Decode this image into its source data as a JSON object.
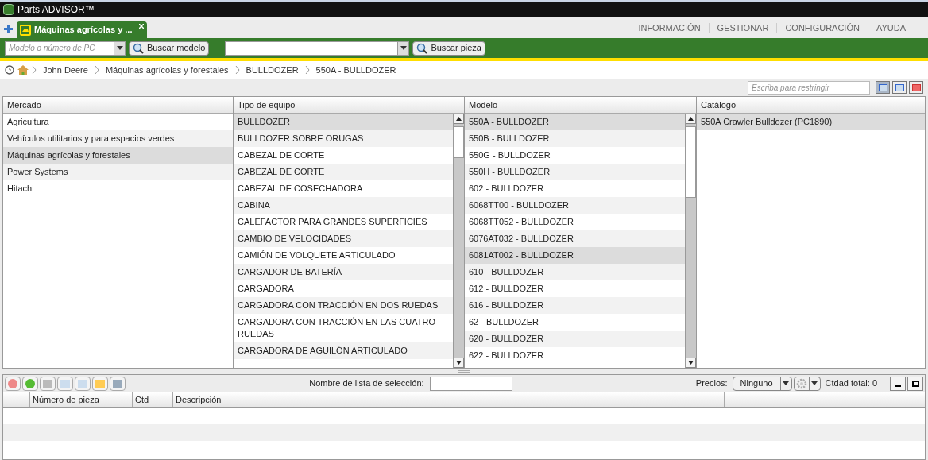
{
  "window": {
    "title": "Parts ADVISOR™"
  },
  "tabs": [
    {
      "label": "Máquinas agrícolas y ...",
      "selected": true
    }
  ],
  "top_menu": [
    "INFORMACIÓN",
    "GESTIONAR",
    "CONFIGURACIÓN",
    "AYUDA"
  ],
  "search": {
    "model_placeholder": "Modelo o número de PC",
    "model_button": "Buscar modelo",
    "part_button": "Buscar pieza"
  },
  "breadcrumb": [
    "John Deere",
    "Máquinas agrícolas y forestales",
    "BULLDOZER",
    "550A - BULLDOZER"
  ],
  "filter": {
    "placeholder": "Escriba para restringir"
  },
  "columns": [
    {
      "header": "Mercado",
      "items": [
        {
          "label": "Agricultura",
          "selected": false
        },
        {
          "label": "Vehículos utilitarios y para espacios verdes",
          "selected": false
        },
        {
          "label": "Máquinas agrícolas y forestales",
          "selected": true
        },
        {
          "label": "Power Systems",
          "selected": false
        },
        {
          "label": "Hitachi",
          "selected": false
        }
      ]
    },
    {
      "header": "Tipo de equipo",
      "items": [
        {
          "label": "BULLDOZER",
          "selected": true
        },
        {
          "label": "BULLDOZER SOBRE ORUGAS",
          "selected": false
        },
        {
          "label": "CABEZAL DE CORTE",
          "selected": false
        },
        {
          "label": "CABEZAL DE CORTE",
          "selected": false
        },
        {
          "label": "CABEZAL DE COSECHADORA",
          "selected": false
        },
        {
          "label": "CABINA",
          "selected": false
        },
        {
          "label": "CALEFACTOR PARA GRANDES SUPERFICIES",
          "selected": false
        },
        {
          "label": "CAMBIO DE VELOCIDADES",
          "selected": false
        },
        {
          "label": "CAMIÓN DE VOLQUETE ARTICULADO",
          "selected": false
        },
        {
          "label": "CARGADOR DE BATERÍA",
          "selected": false
        },
        {
          "label": "CARGADORA",
          "selected": false
        },
        {
          "label": "CARGADORA CON TRACCIÓN EN DOS RUEDAS",
          "selected": false
        },
        {
          "label": "CARGADORA CON TRACCIÓN EN LAS CUATRO RUEDAS",
          "selected": false
        },
        {
          "label": "CARGADORA DE AGUILÓN ARTICULADO",
          "selected": false
        }
      ]
    },
    {
      "header": "Modelo",
      "items": [
        {
          "label": "550A - BULLDOZER",
          "selected": true
        },
        {
          "label": "550B - BULLDOZER",
          "selected": false
        },
        {
          "label": "550G - BULLDOZER",
          "selected": false
        },
        {
          "label": "550H - BULLDOZER",
          "selected": false
        },
        {
          "label": "602 - BULLDOZER",
          "selected": false
        },
        {
          "label": "6068TT00 - BULLDOZER",
          "selected": false
        },
        {
          "label": "6068TT052 - BULLDOZER",
          "selected": false
        },
        {
          "label": "6076AT032 - BULLDOZER",
          "selected": false
        },
        {
          "label": "6081AT002 - BULLDOZER",
          "selected": true
        },
        {
          "label": "610 - BULLDOZER",
          "selected": false
        },
        {
          "label": "612 - BULLDOZER",
          "selected": false
        },
        {
          "label": "616 - BULLDOZER",
          "selected": false
        },
        {
          "label": "62 - BULLDOZER",
          "selected": false
        },
        {
          "label": "620 - BULLDOZER",
          "selected": false
        },
        {
          "label": "622 - BULLDOZER",
          "selected": false
        }
      ]
    },
    {
      "header": "Catálogo",
      "items": [
        {
          "label": "550A Crawler Bulldozer (PC1890)",
          "selected": true
        }
      ]
    }
  ],
  "picklist": {
    "name_label": "Nombre de lista de selección:",
    "prices_label": "Precios:",
    "prices_value": "Ninguno",
    "total": "Ctdad total: 0"
  },
  "parts_table": {
    "columns": [
      "Número de pieza",
      "Ctd",
      "Descripción"
    ]
  }
}
